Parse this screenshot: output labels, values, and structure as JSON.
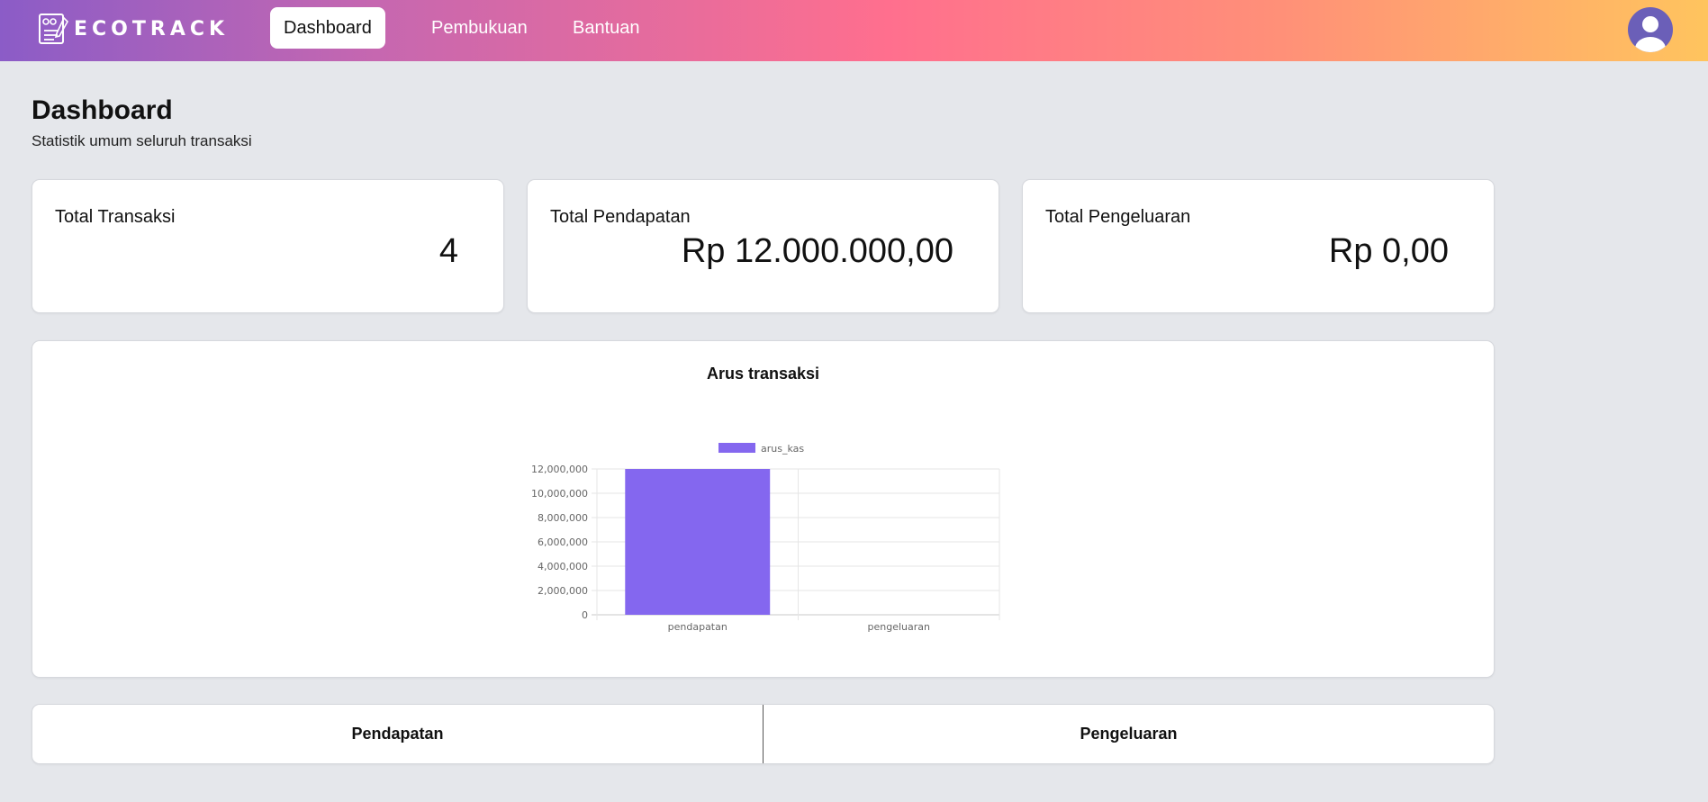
{
  "app": {
    "brand": "ECOTRACK"
  },
  "nav": {
    "items": [
      {
        "label": "Dashboard",
        "active": true
      },
      {
        "label": "Pembukuan",
        "active": false
      },
      {
        "label": "Bantuan",
        "active": false
      }
    ]
  },
  "page": {
    "title": "Dashboard",
    "subtitle": "Statistik umum seluruh transaksi"
  },
  "stats": [
    {
      "label": "Total Transaksi",
      "value": "4"
    },
    {
      "label": "Total Pendapatan",
      "value": "Rp 12.000.000,00"
    },
    {
      "label": "Total Pengeluaran",
      "value": "Rp 0,00"
    }
  ],
  "chart_card": {
    "title": "Arus transaksi"
  },
  "chart_data": {
    "type": "bar",
    "categories": [
      "pendapatan",
      "pengeluaran"
    ],
    "series": [
      {
        "name": "arus_kas",
        "values": [
          12000000,
          0
        ]
      }
    ],
    "ylim": [
      0,
      12000000
    ],
    "yticks": [
      0,
      2000000,
      4000000,
      6000000,
      8000000,
      10000000,
      12000000
    ],
    "ytick_labels": [
      "0",
      "2,000,000",
      "4,000,000",
      "6,000,000",
      "8,000,000",
      "10,000,000",
      "12,000,000"
    ],
    "legend": "top",
    "grid": true,
    "bar_color": "#8467ef"
  },
  "tabs": [
    {
      "label": "Pendapatan"
    },
    {
      "label": "Pengeluaran"
    }
  ]
}
